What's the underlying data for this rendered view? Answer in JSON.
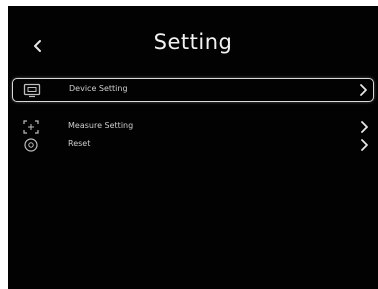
{
  "header": {
    "title": "Setting",
    "back_icon": "chevron-left-icon"
  },
  "menu": {
    "items": [
      {
        "label": "Device Setting",
        "icon": "device-setting-icon",
        "selected": true
      },
      {
        "label": "Measure Setting",
        "icon": "measure-setting-icon",
        "selected": false
      },
      {
        "label": "Reset",
        "icon": "reset-icon",
        "selected": false
      }
    ]
  },
  "colors": {
    "background": "#020202",
    "text": "#f2f2f2",
    "selection_border": "#d9d9d9"
  }
}
